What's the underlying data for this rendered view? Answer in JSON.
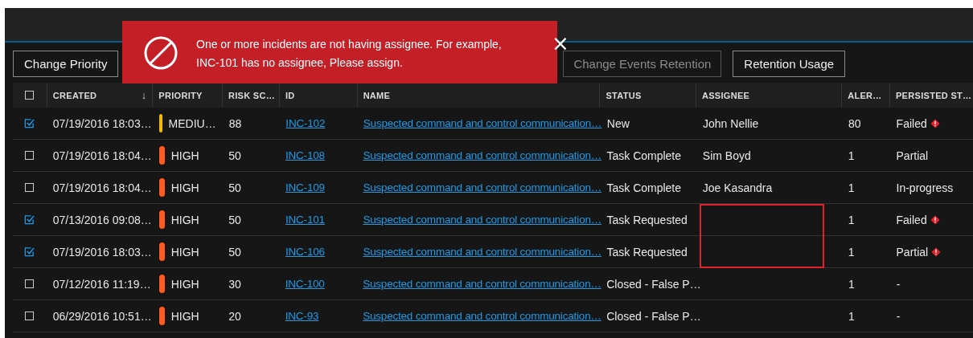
{
  "toast": {
    "message": "One or more incidents are not having assignee. For example, INC-101 has no assignee, Please assign.",
    "close": "×"
  },
  "toolbar": [
    {
      "label": "Change Priority",
      "disabled": false
    },
    {
      "label": "Change Events Retention",
      "disabled": true
    },
    {
      "label": "Retention Usage",
      "disabled": false
    }
  ],
  "table": {
    "select_all_checked": false,
    "columns": [
      {
        "label": "CREATED",
        "sort_icon": "↓"
      },
      {
        "label": "PRIORITY"
      },
      {
        "label": "RISK SC…"
      },
      {
        "label": "ID"
      },
      {
        "label": "NAME"
      },
      {
        "label": "STATUS"
      },
      {
        "label": "ASSIGNEE"
      },
      {
        "label": "ALER…"
      },
      {
        "label": "PERSISTED ST…"
      }
    ],
    "rows": [
      {
        "checked": true,
        "created": "07/19/2016 18:03…",
        "priority": "MEDIU…",
        "color": "#f5b800",
        "risk": "88",
        "id": "INC-102",
        "name": "Suspected command and control communication…",
        "status": "New",
        "assignee": "John Nellie",
        "alerts": "80",
        "persisted": "Failed",
        "warning": true,
        "flagged": false
      },
      {
        "checked": false,
        "created": "07/19/2016 18:04…",
        "priority": "HIGH",
        "color": "#ff5a1f",
        "risk": "50",
        "id": "INC-108",
        "name": "Suspected command and control communication…",
        "status": "Task Complete",
        "assignee": "Sim Boyd",
        "alerts": "1",
        "persisted": "Partial",
        "warning": false,
        "flagged": false
      },
      {
        "checked": false,
        "created": "07/19/2016 18:04…",
        "priority": "HIGH",
        "color": "#ff5a1f",
        "risk": "50",
        "id": "INC-109",
        "name": "Suspected command and control communication…",
        "status": "Task Complete",
        "assignee": "Joe Kasandra",
        "alerts": "1",
        "persisted": "In-progress",
        "warning": false,
        "flagged": false
      },
      {
        "checked": true,
        "created": "07/13/2016 09:08…",
        "priority": "HIGH",
        "color": "#ff5a1f",
        "risk": "50",
        "id": "INC-101",
        "name": "Suspected command and control communication…",
        "status": "Task Requested",
        "alerts": "1",
        "persisted": "Failed",
        "warning": true,
        "flagged": true
      },
      {
        "checked": true,
        "created": "07/19/2016 18:03…",
        "priority": "HIGH",
        "color": "#ff5a1f",
        "risk": "50",
        "id": "INC-106",
        "name": "Suspected command and control communication…",
        "status": "Task Requested",
        "alerts": "1",
        "persisted": "Partial",
        "warning": true,
        "flagged": true
      },
      {
        "checked": false,
        "created": "07/12/2016 11:19…",
        "priority": "HIGH",
        "color": "#ff5a1f",
        "risk": "30",
        "id": "INC-100",
        "name": "Suspected command and control communication…",
        "status": "Closed - False P…",
        "alerts": "1",
        "persisted": "-",
        "warning": false,
        "flagged": false
      },
      {
        "checked": false,
        "created": "06/29/2016 10:51…",
        "priority": "HIGH",
        "color": "#ff5a1f",
        "risk": "20",
        "id": "INC-93",
        "name": "Suspected command and control communication…",
        "status": "Closed - False P…",
        "alerts": "1",
        "persisted": "-",
        "warning": false,
        "flagged": false
      }
    ]
  }
}
